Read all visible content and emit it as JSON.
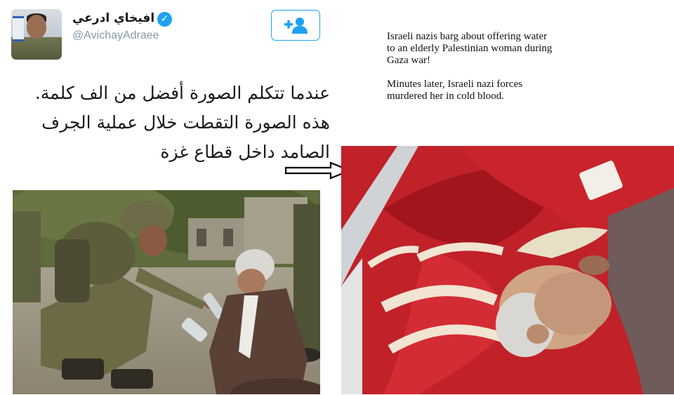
{
  "tweet": {
    "display_name": "افيخاي ادرعي",
    "handle": "@AvichayAdraee",
    "verified_icon": "verified-badge-icon",
    "follow_icon": "add-person-icon",
    "accent_color": "#1da1f2",
    "text_lines": [
      "عندما تتكلم الصورة أفضل من الف كلمة.",
      "هذه الصورة التقطت خلال عملية الجرف",
      "الصامد داخل قطاع غزة"
    ]
  },
  "arrow_icon": "right-arrow-icon",
  "caption": {
    "paragraph1": "Israeli nazis barg about offering water to an elderly Palestinian woman during Gaza war!",
    "paragraph2": "Minutes later, Israeli nazi forces murdered her in cold blood."
  }
}
